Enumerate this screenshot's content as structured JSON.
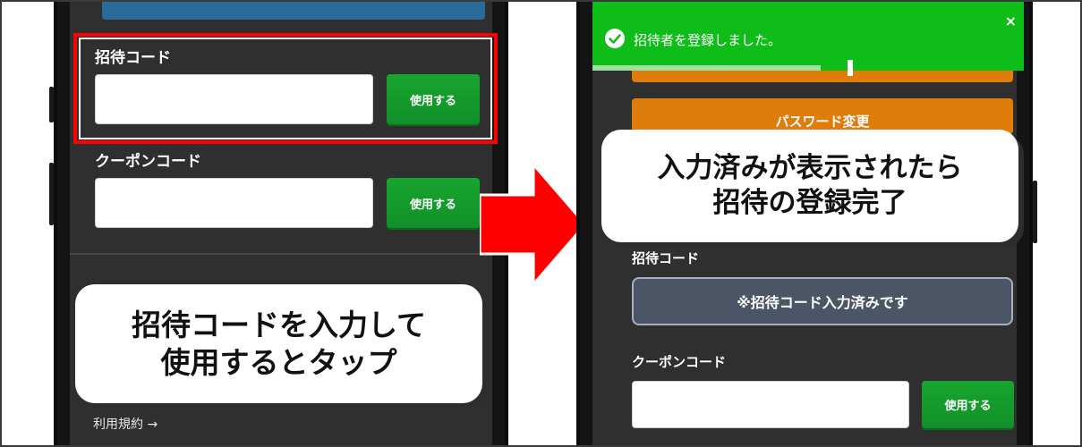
{
  "left_phone": {
    "invite_section_label": "招待コード",
    "invite_input_value": "",
    "invite_use_button": "使用する",
    "coupon_section_label": "クーポンコード",
    "coupon_input_value": "",
    "coupon_use_button": "使用する",
    "footer_link": "利用規約 →"
  },
  "left_callout": {
    "line1": "招待コードを入力して",
    "line2": "使用するとタップ"
  },
  "right_phone": {
    "toast": {
      "message": "招待者を登録しました。",
      "close_label": "×",
      "progress_fraction": 0.53
    },
    "password_button": "パスワード変更",
    "invite_section_label": "招待コード",
    "invite_done_text": "※招待コード入力済みです",
    "coupon_section_label": "クーポンコード",
    "coupon_input_value": "",
    "coupon_use_button": "使用する"
  },
  "right_callout": {
    "line1": "入力済みが表示されたら",
    "line2": "招待の登録完了"
  },
  "colors": {
    "highlight": "#ff0000",
    "use_button": "#12902a",
    "toast": "#0fbd18",
    "orange_button": "#e07c0a",
    "arrow": "#ff0000"
  }
}
